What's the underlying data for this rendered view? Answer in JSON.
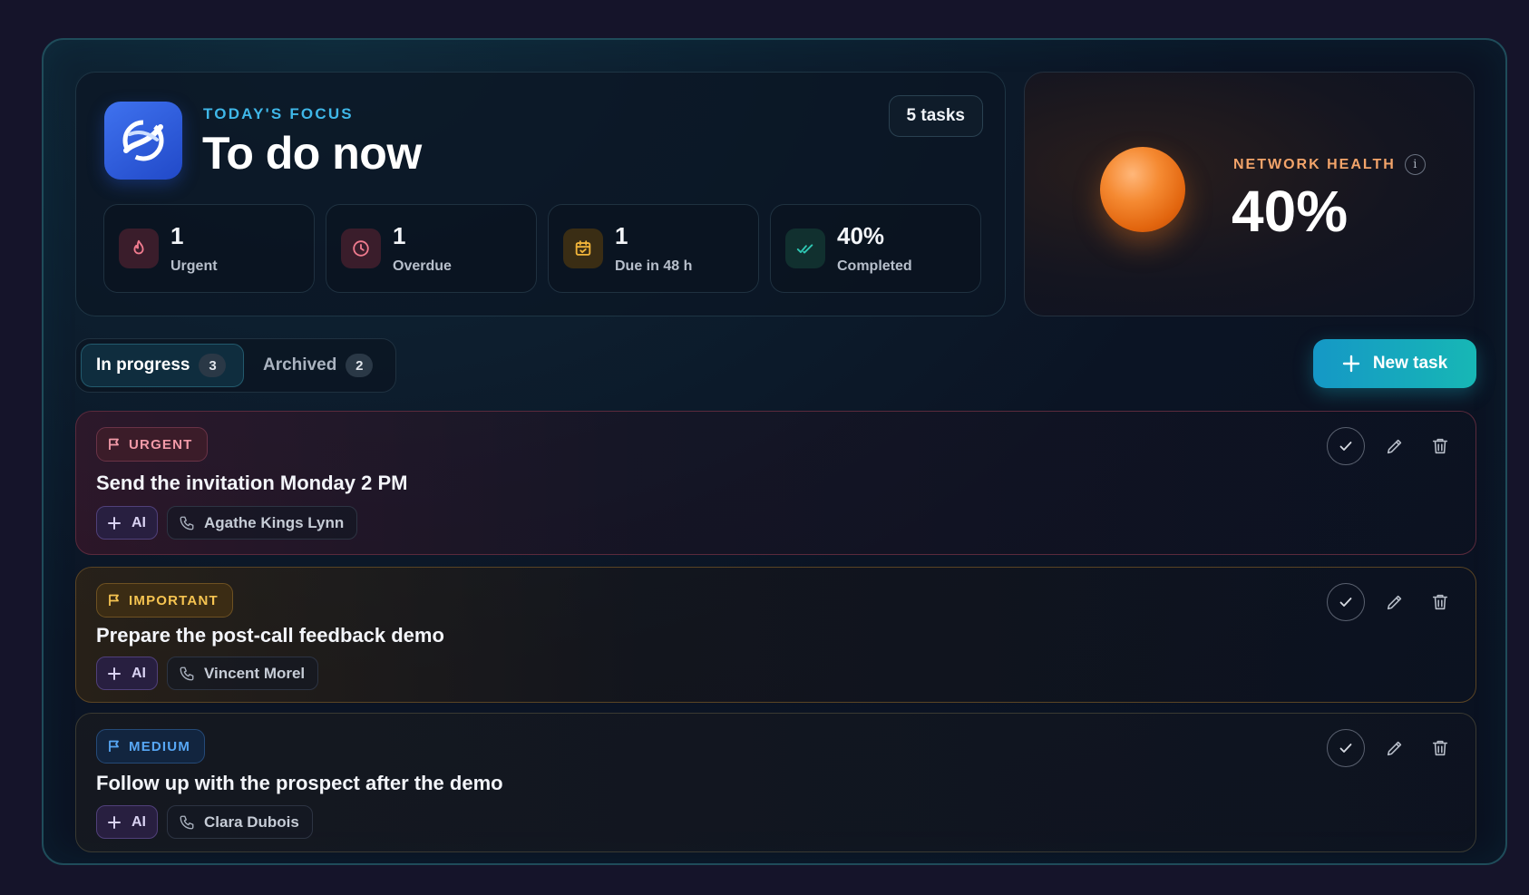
{
  "header": {
    "eyebrow": "TODAY'S FOCUS",
    "title": "To do now",
    "task_count": "5 tasks",
    "logo_icon": "swirl-logo-icon"
  },
  "stats": [
    {
      "value": "1",
      "label": "Urgent",
      "icon": "flame-icon",
      "color": "#f07b8e"
    },
    {
      "value": "1",
      "label": "Overdue",
      "icon": "clock-icon",
      "color": "#f07b8e"
    },
    {
      "value": "1",
      "label": "Due in 48 h",
      "icon": "calendar-icon",
      "color": "#f2b53a"
    },
    {
      "value": "40%",
      "label": "Completed",
      "icon": "double-check-icon",
      "color": "#2fc7b3"
    }
  ],
  "health": {
    "label": "NETWORK HEALTH",
    "value": "40%",
    "info": "i"
  },
  "tabs": [
    {
      "label": "In progress",
      "count": "3",
      "active": true
    },
    {
      "label": "Archived",
      "count": "2",
      "active": false
    }
  ],
  "new_task_label": "New task",
  "tasks": [
    {
      "priority": "URGENT",
      "title": "Send the invitation Monday 2 PM",
      "ai_label": "AI",
      "contact": "Agathe Kings Lynn",
      "accent": "#f29aa8"
    },
    {
      "priority": "IMPORTANT",
      "title": "Prepare the post-call feedback demo",
      "ai_label": "AI",
      "contact": "Vincent Morel",
      "accent": "#f6c451"
    },
    {
      "priority": "MEDIUM",
      "title": "Follow up with the prospect after the demo",
      "ai_label": "AI",
      "contact": "Clara Dubois",
      "accent": "#57a7f5"
    }
  ],
  "colors": {
    "accent_teal": "#17b7b5",
    "accent_blue": "#3fb7e8",
    "orb_orange": "#f58a32"
  }
}
